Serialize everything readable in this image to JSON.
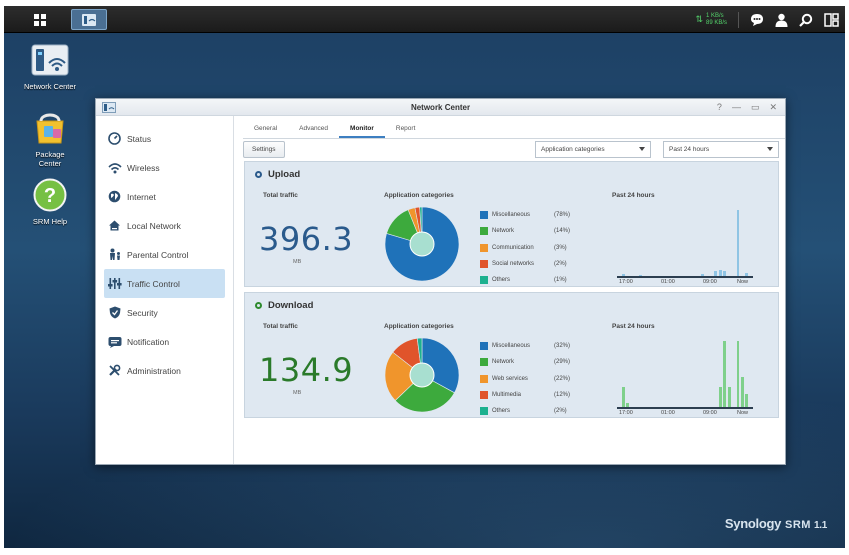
{
  "taskbar": {
    "upload_rate": "1 KB/s",
    "download_rate": "89 KB/s",
    "icons": [
      "main-menu-icon",
      "network-center-icon",
      "chat-icon",
      "user-icon",
      "search-icon",
      "widgets-icon"
    ]
  },
  "desktop": {
    "icons": [
      {
        "label": "Network Center",
        "icon": "network-center-icon"
      },
      {
        "label": "Package Center",
        "icon": "package-center-icon"
      },
      {
        "label": "SRM Help",
        "icon": "help-icon"
      }
    ],
    "brand": {
      "name": "Synology",
      "product": "SRM",
      "version": "1.1"
    }
  },
  "window": {
    "title": "Network Center",
    "controls": [
      "?",
      "—",
      "▭",
      "✕"
    ],
    "sidebar": {
      "items": [
        {
          "label": "Status",
          "icon": "status-icon"
        },
        {
          "label": "Wireless",
          "icon": "wireless-icon"
        },
        {
          "label": "Internet",
          "icon": "globe-icon"
        },
        {
          "label": "Local Network",
          "icon": "home-network-icon"
        },
        {
          "label": "Parental Control",
          "icon": "parental-icon"
        },
        {
          "label": "Traffic Control",
          "icon": "traffic-control-icon",
          "active": true
        },
        {
          "label": "Security",
          "icon": "shield-icon"
        },
        {
          "label": "Notification",
          "icon": "notification-icon"
        },
        {
          "label": "Administration",
          "icon": "tools-icon"
        }
      ]
    },
    "tabs": [
      "General",
      "Advanced",
      "Monitor",
      "Report"
    ],
    "active_tab": "Monitor",
    "toolbar": {
      "settings_label": "Settings",
      "category_select": "Application categories",
      "range_select": "Past 24 hours"
    }
  },
  "upload": {
    "title": "Upload",
    "total_label": "Total traffic",
    "total_value": "396.3",
    "unit": "MB",
    "categories_label": "Application categories",
    "history_label": "Past 24 hours",
    "color": "#2a5a8c",
    "legend": [
      {
        "name": "Miscellaneous",
        "pct": "(78%)",
        "value": 78,
        "color": "#1f72b9"
      },
      {
        "name": "Network",
        "pct": "(14%)",
        "value": 14,
        "color": "#3daa3d"
      },
      {
        "name": "Communication",
        "pct": "(3%)",
        "value": 3,
        "color": "#f0952c"
      },
      {
        "name": "Social networks",
        "pct": "(2%)",
        "value": 2,
        "color": "#e0542b"
      },
      {
        "name": "Others",
        "pct": "(1%)",
        "value": 1,
        "color": "#1db18f"
      }
    ],
    "bars": [
      0.03,
      0,
      0,
      0,
      0.02,
      0,
      0,
      0,
      0,
      0,
      0,
      0,
      0,
      0,
      0,
      0,
      0,
      0,
      0.03,
      0,
      0,
      0.08,
      0.09,
      0.08,
      0,
      0,
      1.0,
      0,
      0.05
    ],
    "bar_color": "#8fc4e4",
    "ticks": [
      "17:00",
      "01:00",
      "09:00",
      "Now"
    ]
  },
  "download": {
    "title": "Download",
    "total_label": "Total traffic",
    "total_value": "134.9",
    "unit": "MB",
    "categories_label": "Application categories",
    "history_label": "Past 24 hours",
    "color": "#2a7a2a",
    "legend": [
      {
        "name": "Miscellaneous",
        "pct": "(32%)",
        "value": 32,
        "color": "#1f72b9"
      },
      {
        "name": "Network",
        "pct": "(29%)",
        "value": 29,
        "color": "#3daa3d"
      },
      {
        "name": "Web services",
        "pct": "(22%)",
        "value": 22,
        "color": "#f0952c"
      },
      {
        "name": "Multimedia",
        "pct": "(12%)",
        "value": 12,
        "color": "#e0542b"
      },
      {
        "name": "Others",
        "pct": "(2%)",
        "value": 2,
        "color": "#1db18f"
      }
    ],
    "bars": [
      0.3,
      0.06,
      0,
      0,
      0,
      0,
      0,
      0,
      0,
      0,
      0,
      0,
      0,
      0,
      0,
      0,
      0,
      0,
      0,
      0,
      0,
      0,
      0.3,
      1.0,
      0.3,
      0,
      1.0,
      0.45,
      0.2
    ],
    "bar_color": "#7fd08b",
    "ticks": [
      "17:00",
      "01:00",
      "09:00",
      "Now"
    ]
  }
}
